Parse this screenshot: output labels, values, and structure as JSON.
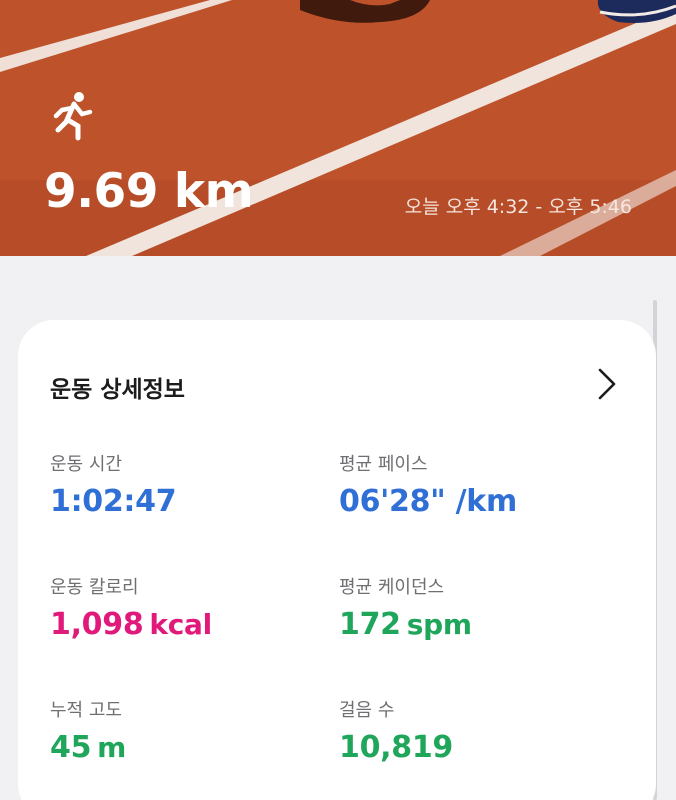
{
  "hero": {
    "distance": "9.69 km",
    "time_range": "오늘 오후 4:32 - 오후 5:46",
    "activity_icon": "running-person-icon"
  },
  "card": {
    "title": "운동 상세정보",
    "chevron_icon": "chevron-right-icon",
    "stats": {
      "duration": {
        "label": "운동 시간",
        "value": "1:02:47",
        "unit": "",
        "color": "#2f6fd6"
      },
      "pace": {
        "label": "평균 페이스",
        "value": "06'28\" /km",
        "unit": "",
        "color": "#2f6fd6"
      },
      "calories": {
        "label": "운동 칼로리",
        "value": "1,098",
        "unit": "kcal",
        "color": "#e0197a"
      },
      "cadence": {
        "label": "평균 케이던스",
        "value": "172",
        "unit": "spm",
        "color": "#1fa65b"
      },
      "elevation": {
        "label": "누적 고도",
        "value": "45",
        "unit": "m",
        "color": "#1fa65b"
      },
      "steps": {
        "label": "걸음 수",
        "value": "10,819",
        "unit": "",
        "color": "#1fa65b"
      }
    }
  }
}
